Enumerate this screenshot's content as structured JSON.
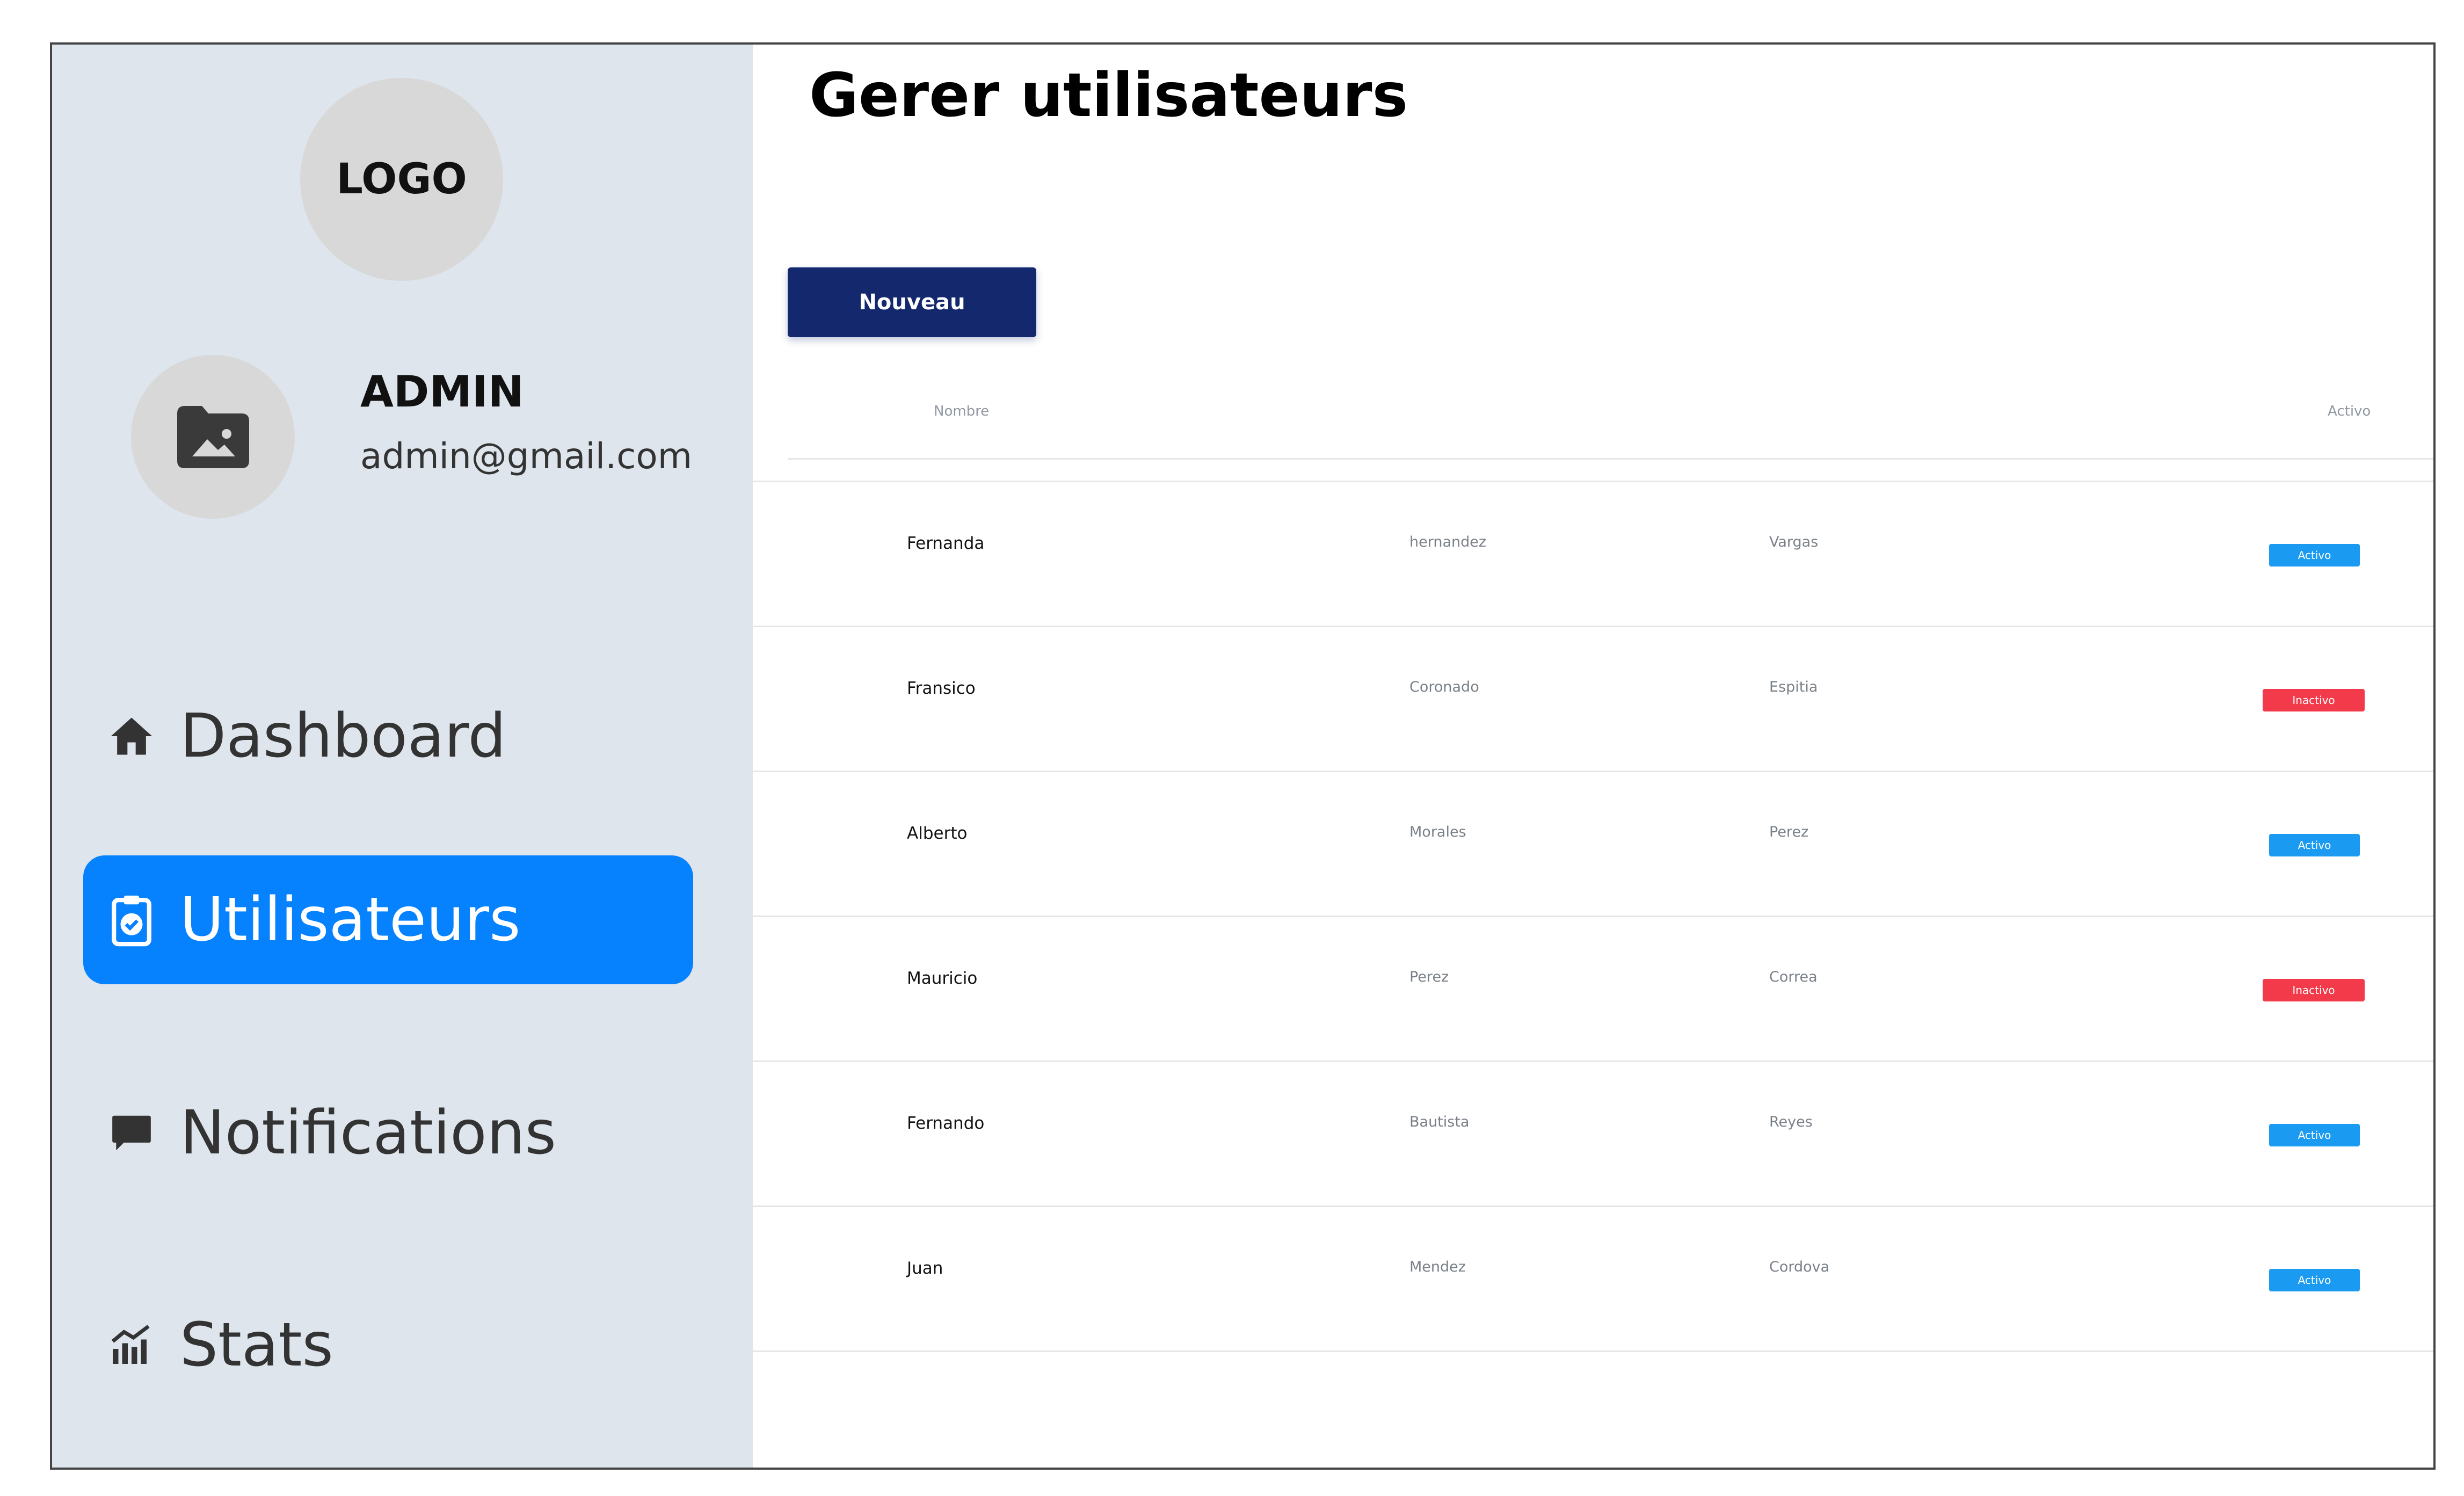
{
  "sidebar": {
    "logo_text": "LOGO",
    "user": {
      "name": "ADMIN",
      "email": "admin@gmail.com"
    },
    "nav": [
      {
        "label": "Dashboard",
        "icon": "home-icon",
        "active": false
      },
      {
        "label": "Utilisateurs",
        "icon": "clipboard-check-icon",
        "active": true
      },
      {
        "label": "Notifications",
        "icon": "chat-bubble-icon",
        "active": false
      },
      {
        "label": "Stats",
        "icon": "bar-chart-icon",
        "active": false
      }
    ]
  },
  "main": {
    "title": "Gerer utilisateurs",
    "new_button": "Nouveau",
    "table": {
      "headers": {
        "name": "Nombre",
        "status": "Activo"
      },
      "rows": [
        {
          "first": "Fernanda",
          "second": "hernandez",
          "third": "Vargas",
          "status": "Activo"
        },
        {
          "first": "Fransico",
          "second": "Coronado",
          "third": "Espitia",
          "status": "Inactivo"
        },
        {
          "first": "Alberto",
          "second": "Morales",
          "third": "Perez",
          "status": "Activo"
        },
        {
          "first": "Mauricio",
          "second": "Perez",
          "third": "Correa",
          "status": "Inactivo"
        },
        {
          "first": "Fernando",
          "second": "Bautista",
          "third": "Reyes",
          "status": "Activo"
        },
        {
          "first": "Juan",
          "second": "Mendez",
          "third": "Cordova",
          "status": "Activo"
        }
      ]
    }
  },
  "colors": {
    "sidebar_bg": "#dee5ec",
    "active_nav": "#0682ff",
    "primary_button": "#14286e",
    "badge_active": "#1a9af0",
    "badge_inactive": "#f23a4b"
  }
}
